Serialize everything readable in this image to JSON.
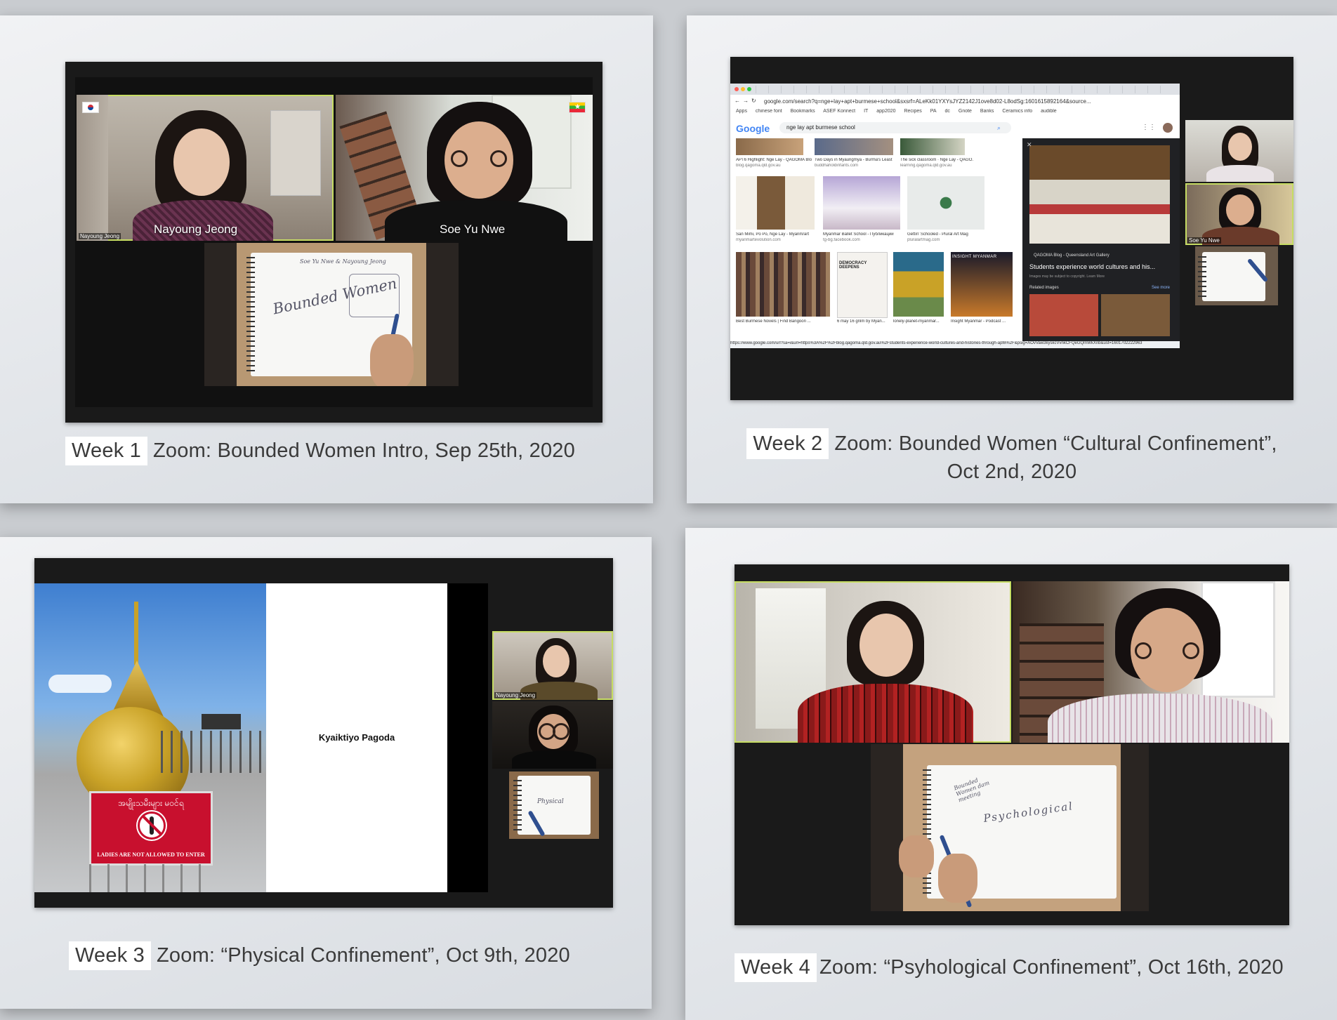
{
  "slides": {
    "week1": {
      "week_label": "Week 1",
      "caption": "Zoom: Bounded Women Intro, Sep 25th, 2020",
      "participant_1": "Nayoung Jeong",
      "participant_1_small": "Nayoung Jeong",
      "participant_2": "Soe Yu Nwe",
      "notebook_title": "Soe Yu Nwe & Nayoung Jeong",
      "notebook_text": "Bounded Women"
    },
    "week2": {
      "week_label": "Week 2",
      "caption_line1": "Zoom: Bounded Women “Cultural Confinement”,",
      "caption_line2": "Oct 2nd, 2020",
      "url": "google.com/search?q=nge+lay+apt+burmese+school&sxsrf=ALeKk01YXYsJYZ2142J1ove8d02-L8odSg:1601615892164&source...",
      "search_query": "nge lay apt burmese school",
      "google_logo": "Google",
      "bookmarks": [
        "Apps",
        "chinese font",
        "Bookmarks",
        "ASEF Konnect",
        "IT",
        "app2020",
        "Recipes",
        "PA",
        "dc",
        "Gnote",
        "Banks",
        "Ceramics info",
        "audible"
      ],
      "results": [
        {
          "title": "APT6 Highlight: Nge Lay - QAGOMA Blog",
          "source": "blog.qagoma.qld.gov.au"
        },
        {
          "title": "Two Days in Myaungmya - Burma's Least ...",
          "source": "buddhaholdinfants.com"
        },
        {
          "title": "The sick classroom · Nge Lay - QAGO...",
          "source": "learning.qagoma.qld.gov.au"
        },
        {
          "title": "San Mimi, Po Po, Nge Lay - Myanm/art",
          "source": "myanmartevolution.com"
        },
        {
          "title": "Myanmar Ballet School - Публикации",
          "source": "tg-bg.facebook.com"
        },
        {
          "title": "Gettin' Schooled - Plural Art Mag",
          "source": "pluralartmag.com"
        },
        {
          "title": "Best Burmese Novels | Find Bangoon ...",
          "source": ""
        },
        {
          "title": "6 may 16 gnlm by Myan...",
          "source": ""
        },
        {
          "title": "lonely-planet-myanmar...",
          "source": ""
        },
        {
          "title": "Insight Myanmar - Podcast ...",
          "source": ""
        }
      ],
      "thumb_text_1": "DEMOCRACY DEEPENS",
      "thumb_text_2": "INSIGHT MYANMAR",
      "panel_source": "QAGOMA Blog - Queensland Art Gallery",
      "panel_title": "Students experience world cultures and his...",
      "panel_note": "Images may be subject to copyright. Learn More",
      "panel_related": "Related images",
      "panel_see_more": "See more",
      "status_url": "https://www.google.com/url?sa=i&url=https%3A%2F%2Fblog.qagoma.qld.gov.au%2Fstudents-experience-world-cultures-and-histories-through-apt6%2F&psig=AOvVaw3kyskcVvnkCFQeGQmWkXnb&ust=1601702222963",
      "participant_small": "Soe Yu Nwe"
    },
    "week3": {
      "week_label": "Week 3",
      "caption": "Zoom: “Physical Confinement”, Oct 9th, 2020",
      "slide_text": "Kyaiktiyo Pagoda",
      "sign_burmese": "အမျိုးသမီးများ မဝင်ရ",
      "sign_english": "LADIES ARE NOT ALLOWED TO ENTER",
      "participant_small": "Nayoung Jeong",
      "notebook_text": "Physical"
    },
    "week4": {
      "week_label": "Week 4",
      "caption": "Zoom: “Psyhological Confinement”, Oct 16th, 2020",
      "notebook_title": "Bounded Women dam meeting",
      "notebook_text": "Psychological"
    }
  },
  "colors": {
    "active_speaker": "#c6dc63",
    "zoom_bg": "#1a1a1a",
    "google_blue": "#4285f4",
    "sign_red": "#c8102e",
    "pagoda_gold": "#c9a227"
  }
}
